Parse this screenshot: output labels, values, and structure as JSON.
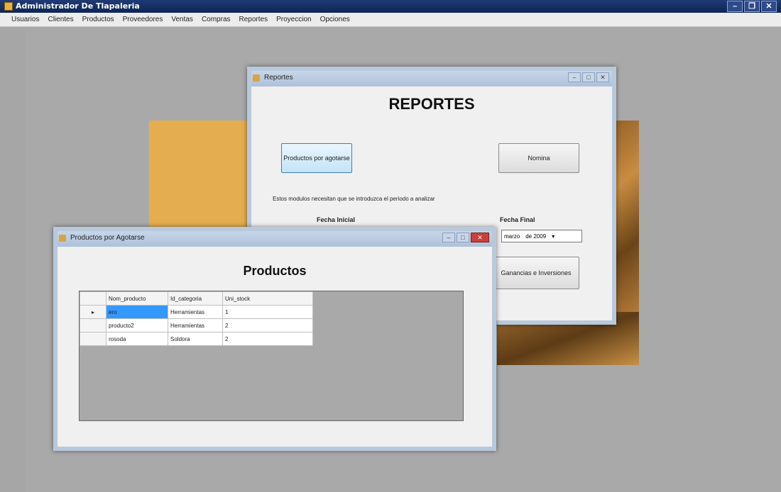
{
  "app": {
    "title": "Administrador De Tlapaleria",
    "controls": [
      "–",
      "❐",
      "✕"
    ]
  },
  "menu": [
    "Usuarios",
    "Clientes",
    "Productos",
    "Proveedores",
    "Ventas",
    "Compras",
    "Reportes",
    "Proyeccion",
    "Opciones"
  ],
  "reportes_window": {
    "title": "Reportes",
    "heading": "REPORTES",
    "btn_productos": "Productos por agotarse",
    "btn_nomina": "Nomina",
    "note": "Estos modulos necesitan que se introduzca el periodo a analizar",
    "fecha_inicial": "Fecha Inicial",
    "fecha_final": "Fecha Final",
    "date_value": [
      "marzo",
      "de 2009"
    ],
    "btn_ganancias": "Ganancias e Inversiones"
  },
  "productos_window": {
    "title": "Productos por Agotarse",
    "heading": "Productos",
    "columns": [
      "Nom_producto",
      "Id_categoria",
      "Uni_stock"
    ],
    "rows": [
      [
        "ero",
        "Herramientas",
        "1"
      ],
      [
        "producto2",
        "Herramientas",
        "2"
      ],
      [
        "rosoda",
        "Soldora",
        "2"
      ]
    ]
  },
  "colors": {
    "titlebar": "#0e2556",
    "mdi_background": "#a9a9a9",
    "selection": "#3399ff"
  }
}
